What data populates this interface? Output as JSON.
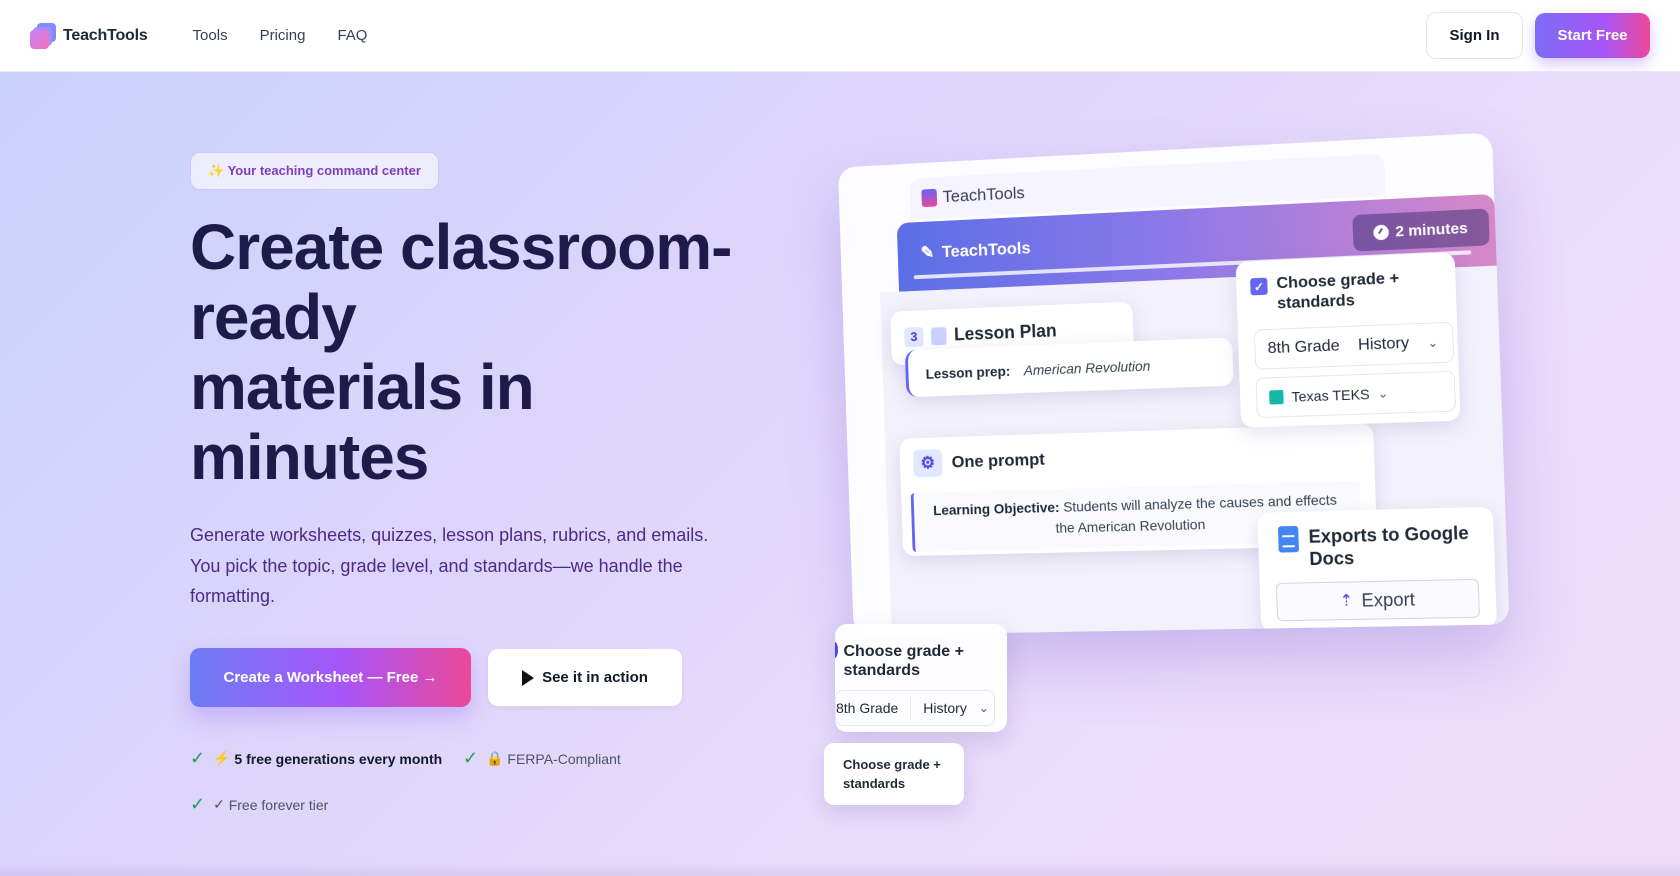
{
  "nav": {
    "brand": "TeachTools",
    "links": [
      "Tools",
      "Pricing",
      "FAQ"
    ],
    "sign_in": "Sign In",
    "start_free": "Start Free"
  },
  "hero": {
    "badge": "✨ Your teaching command center",
    "headline_lines": [
      "Create classroom-",
      "ready",
      "materials in",
      "minutes"
    ],
    "subtitle": "Generate worksheets, quizzes, lesson plans, rubrics, and emails. You pick the topic, grade level, and standards—we handle the formatting.",
    "cta_primary": "Create a Worksheet — Free →",
    "cta_secondary": "See it in action",
    "trust": [
      {
        "icon": "⚡",
        "text": "5 free generations every month",
        "bold": true
      },
      {
        "icon": "🔒",
        "text": "FERPA-Compliant",
        "bold": false
      },
      {
        "icon": "✓",
        "text": "Free forever tier",
        "bold": false
      }
    ]
  },
  "mockup": {
    "tab_title": "TeachTools",
    "header_title": "TeachTools",
    "time_badge": "2 minutes",
    "lesson": {
      "number": "3",
      "title": "Lesson Plan",
      "prep_label": "Lesson prep:",
      "prep_value": "American Revolution"
    },
    "prompt": {
      "title": "One prompt",
      "label": "Learning Objective:",
      "text_line1": "Students will analyze the causes and effects",
      "text_line2": "the American Revolution"
    },
    "grade_card": {
      "title": "Choose grade + standards",
      "grade": "8th Grade",
      "subject": "History",
      "standard": "Texas TEKS"
    },
    "export": {
      "title": "Exports to Google Docs",
      "button": "Export"
    },
    "float_grade": {
      "title": "Choose grade + standards",
      "grade": "8th Grade",
      "subject": "History"
    },
    "float_small": "Choose grade + standards"
  }
}
